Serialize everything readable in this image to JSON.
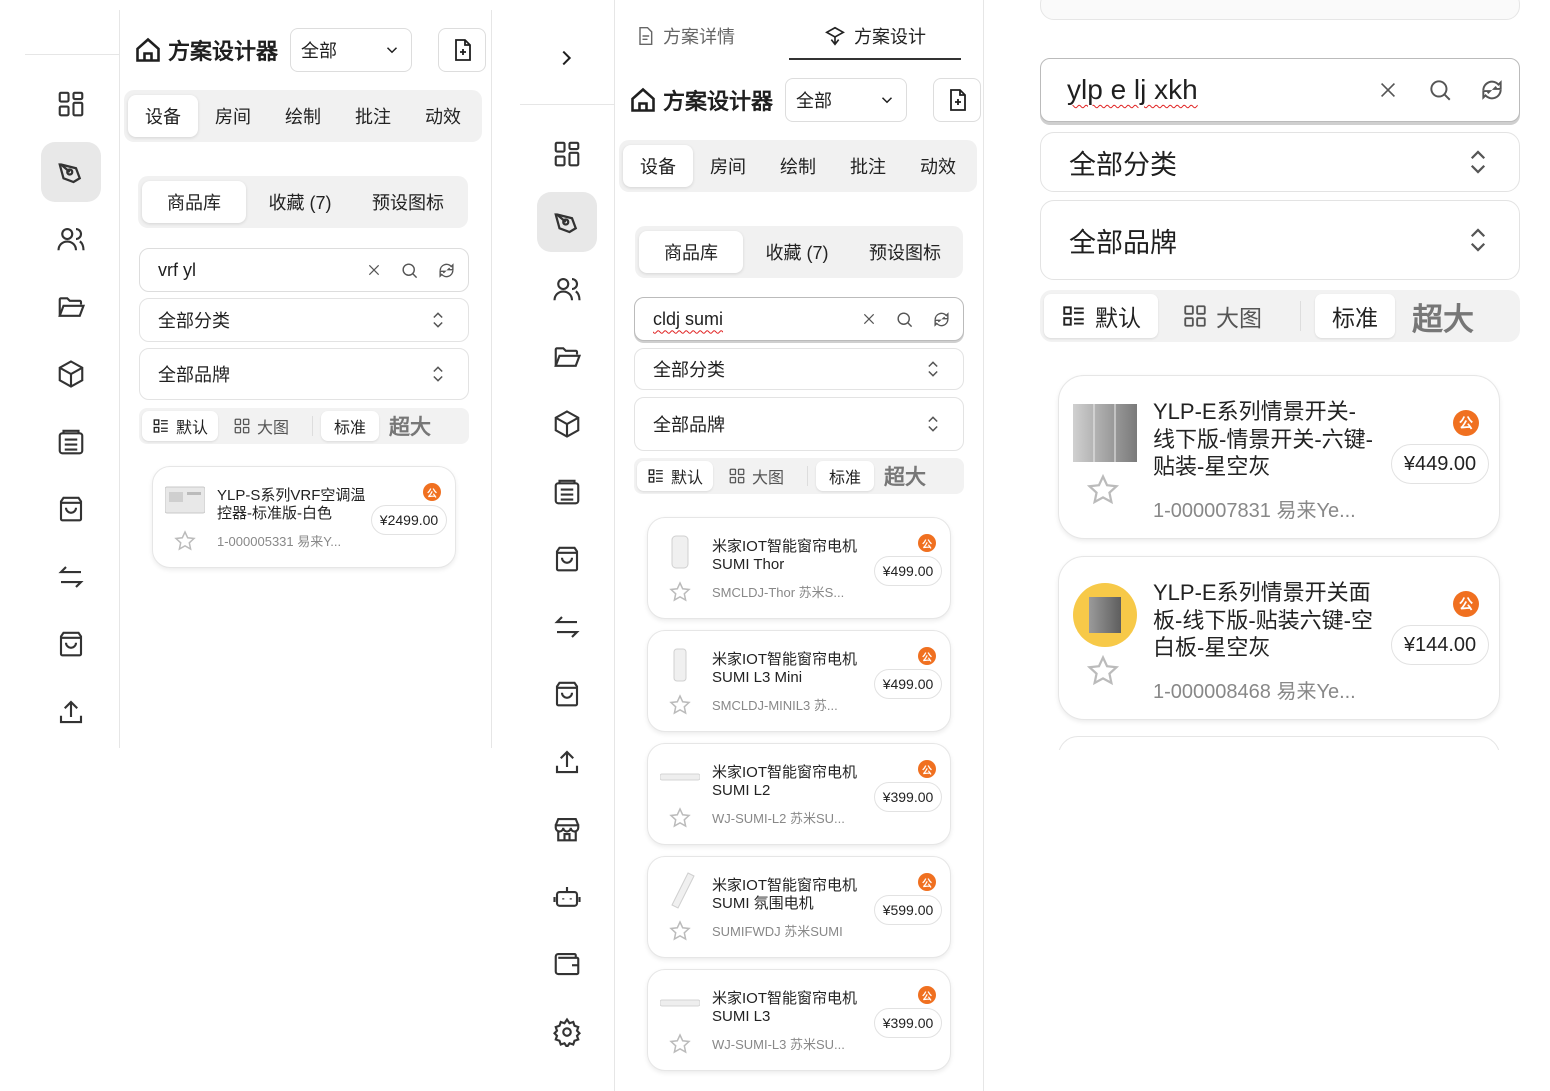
{
  "panel1": {
    "title": "方案设计器",
    "scope": "全部",
    "tabs": [
      "设备",
      "房间",
      "绘制",
      "批注",
      "动效"
    ],
    "subtabs": [
      "商品库",
      "收藏 (7)",
      "预设图标"
    ],
    "search": "vrf yl",
    "category": "全部分类",
    "brand": "全部品牌",
    "views": {
      "default": "默认",
      "large": "大图",
      "standard": "标准",
      "xl": "超大"
    },
    "products": [
      {
        "name": "YLP-S系列VRF空调温控器-标准版-白色",
        "price": "¥2499.00",
        "sku": "1-000005331 易来Y...",
        "badge": "公"
      }
    ]
  },
  "panel2": {
    "top_tabs": [
      "方案详情",
      "方案设计"
    ],
    "title": "方案设计器",
    "scope": "全部",
    "tabs": [
      "设备",
      "房间",
      "绘制",
      "批注",
      "动效"
    ],
    "subtabs": [
      "商品库",
      "收藏 (7)",
      "预设图标"
    ],
    "search": "cldj sumi",
    "category": "全部分类",
    "brand": "全部品牌",
    "views": {
      "default": "默认",
      "large": "大图",
      "standard": "标准",
      "xl": "超大"
    },
    "products": [
      {
        "name": "米家IOT智能窗帘电机SUMI Thor",
        "price": "¥499.00",
        "sku": "SMCLDJ-Thor 苏米S...",
        "badge": "公"
      },
      {
        "name": "米家IOT智能窗帘电机SUMI L3 Mini",
        "price": "¥499.00",
        "sku": "SMCLDJ-MINIL3 苏...",
        "badge": "公"
      },
      {
        "name": "米家IOT智能窗帘电机SUMI L2",
        "price": "¥399.00",
        "sku": "WJ-SUMI-L2 苏米SU...",
        "badge": "公"
      },
      {
        "name": "米家IOT智能窗帘电机SUMI 氛围电机",
        "price": "¥599.00",
        "sku": "SUMIFWDJ 苏米SUMI",
        "badge": "公"
      },
      {
        "name": "米家IOT智能窗帘电机SUMI L3",
        "price": "¥399.00",
        "sku": "WJ-SUMI-L3 苏米SU...",
        "badge": "公"
      }
    ]
  },
  "panel3": {
    "search": "ylp e lj xkh",
    "category": "全部分类",
    "brand": "全部品牌",
    "views": {
      "default": "默认",
      "large": "大图",
      "standard": "标准",
      "xl": "超大"
    },
    "products": [
      {
        "name": "YLP-E系列情景开关-线下版-情景开关-六键-贴装-星空灰",
        "price": "¥449.00",
        "sku": "1-000007831 易来Ye...",
        "badge": "公"
      },
      {
        "name": "YLP-E系列情景开关面板-线下版-贴装六键-空白板-星空灰",
        "price": "¥144.00",
        "sku": "1-000008468 易来Ye...",
        "badge": "公"
      }
    ]
  },
  "colors": {
    "accent": "#f07020",
    "active_bg": "#e8e8e8",
    "border": "#dddddd"
  },
  "rail_icons_left": [
    "grid-icon",
    "pen-icon",
    "users-icon",
    "folder-icon",
    "cube-icon",
    "archive-icon",
    "bag-icon",
    "swap-icon",
    "bag-icon",
    "upload-icon"
  ],
  "rail_icons_mid": [
    "grid-icon",
    "pen-icon",
    "users-icon",
    "folder-icon",
    "cube-icon",
    "archive-icon",
    "bag-icon",
    "swap-icon",
    "bag-icon",
    "upload-icon",
    "store-icon",
    "robot-icon",
    "wallet-icon",
    "gear-icon"
  ]
}
